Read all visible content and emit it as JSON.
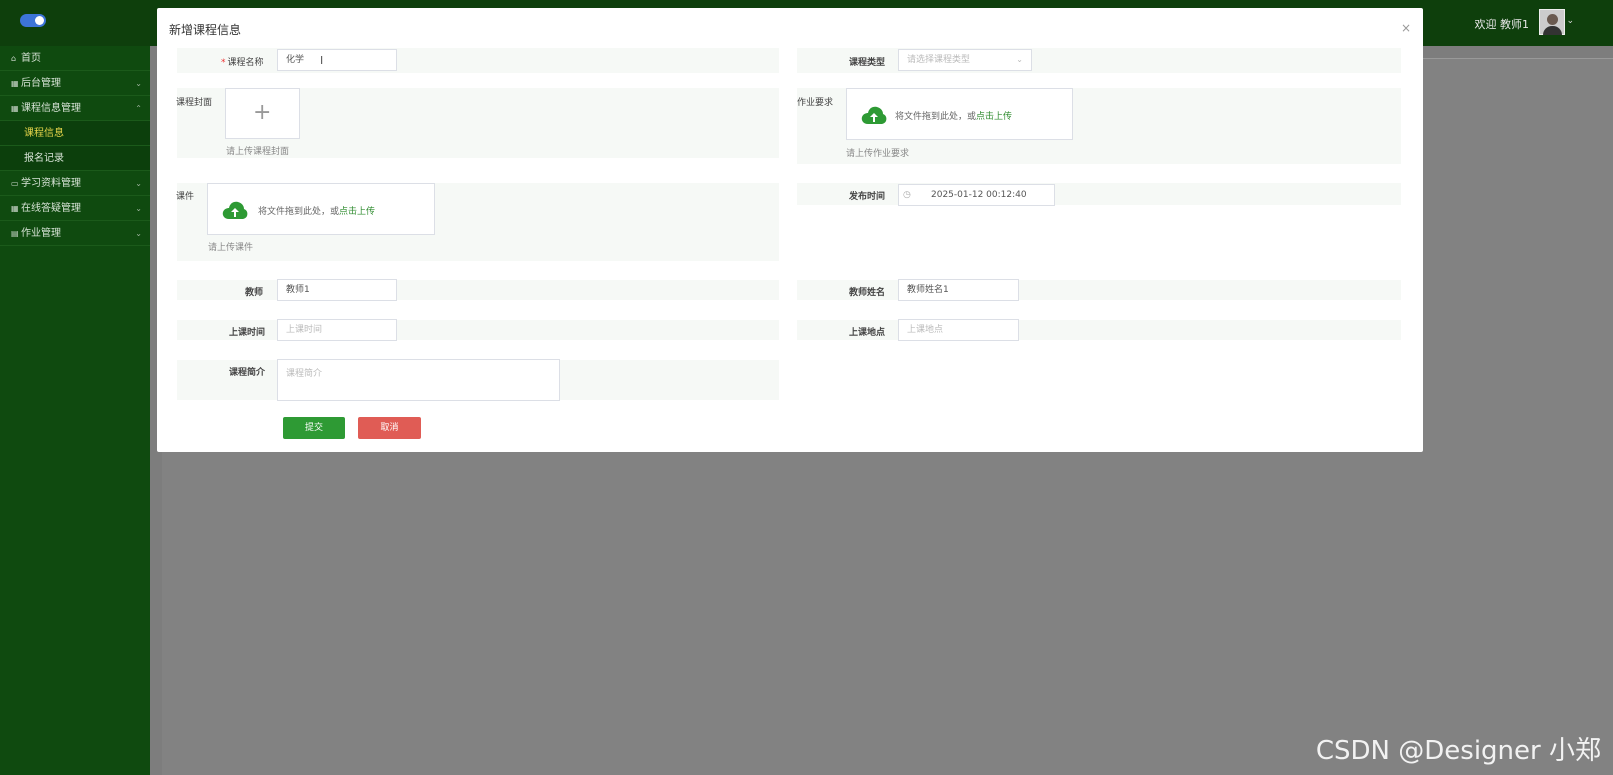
{
  "header": {
    "welcome_text": "欢迎 教师1"
  },
  "sidebar": {
    "items": [
      {
        "label": "首页",
        "icon": "home-icon"
      },
      {
        "label": "后台管理",
        "icon": "list-icon"
      },
      {
        "label": "课程信息管理",
        "icon": "list-icon"
      },
      {
        "label": "课程信息",
        "icon": ""
      },
      {
        "label": "报名记录",
        "icon": ""
      },
      {
        "label": "学习资料管理",
        "icon": "folder-icon"
      },
      {
        "label": "在线答疑管理",
        "icon": "list-icon"
      },
      {
        "label": "作业管理",
        "icon": "doc-icon"
      }
    ]
  },
  "dialog": {
    "title": "新增课程信息",
    "fields": {
      "course_name": {
        "label": "课程名称",
        "value": "化学"
      },
      "course_type": {
        "label": "课程类型",
        "placeholder": "请选择课程类型"
      },
      "cover": {
        "label": "课程封面",
        "hint": "请上传课程封面"
      },
      "homework": {
        "label": "作业要求",
        "upload_text": "将文件拖到此处，或",
        "upload_link": "点击上传",
        "hint": "请上传作业要求"
      },
      "courseware": {
        "label": "课件",
        "upload_text": "将文件拖到此处，或",
        "upload_link": "点击上传",
        "hint": "请上传课件"
      },
      "publish_time": {
        "label": "发布时间",
        "value": "2025-01-12 00:12:40"
      },
      "teacher": {
        "label": "教师",
        "value": "教师1"
      },
      "teacher_name": {
        "label": "教师姓名",
        "value": "教师姓名1"
      },
      "class_time": {
        "label": "上课时间",
        "placeholder": "上课时间"
      },
      "class_place": {
        "label": "上课地点",
        "placeholder": "上课地点"
      },
      "intro": {
        "label": "课程简介",
        "placeholder": "课程简介"
      }
    },
    "buttons": {
      "submit": "提交",
      "cancel": "取消"
    }
  },
  "colors": {
    "header_bg": "#0e3f0c",
    "sidebar_bg": "#0f4a0f",
    "accent_green": "#2e9a34",
    "cancel_red": "#e05c55"
  },
  "watermark": "CSDN @Designer 小郑"
}
